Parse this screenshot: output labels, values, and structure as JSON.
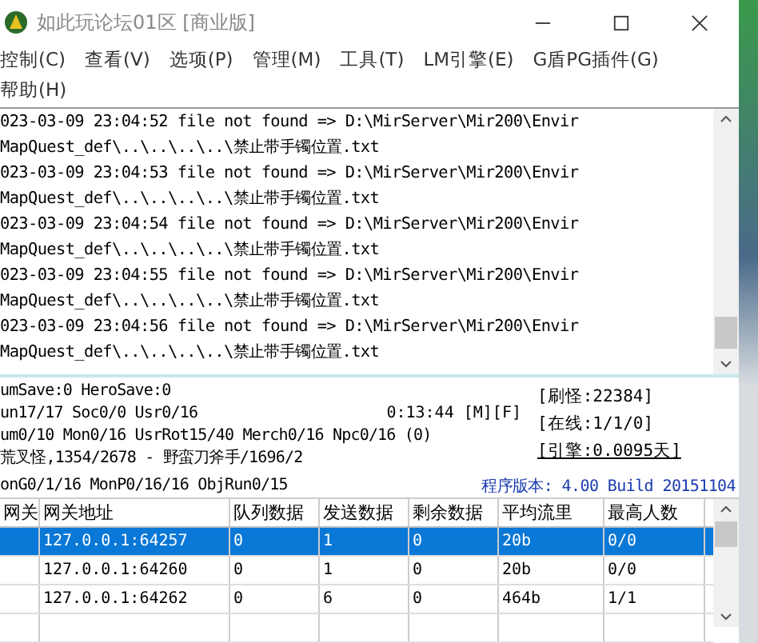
{
  "window": {
    "title": "如此玩论坛01区 [商业版]"
  },
  "menu": [
    {
      "label": "控制(C)"
    },
    {
      "label": "查看(V)"
    },
    {
      "label": "选项(P)"
    },
    {
      "label": "管理(M)"
    },
    {
      "label": "工具(T)"
    },
    {
      "label": "LM引擎(E)"
    },
    {
      "label": "G盾PG插件(G)"
    },
    {
      "label": "帮助(H)"
    }
  ],
  "log": [
    "023-03-09 23:04:52 file not found => D:\\MirServer\\Mir200\\Envir",
    "MapQuest_def\\..\\..\\..\\..\\禁止带手镯位置.txt",
    "023-03-09 23:04:53 file not found => D:\\MirServer\\Mir200\\Envir",
    "MapQuest_def\\..\\..\\..\\..\\禁止带手镯位置.txt",
    "023-03-09 23:04:54 file not found => D:\\MirServer\\Mir200\\Envir",
    "MapQuest_def\\..\\..\\..\\..\\禁止带手镯位置.txt",
    "023-03-09 23:04:55 file not found => D:\\MirServer\\Mir200\\Envir",
    "MapQuest_def\\..\\..\\..\\..\\禁止带手镯位置.txt",
    "023-03-09 23:04:56 file not found => D:\\MirServer\\Mir200\\Envir",
    "MapQuest_def\\..\\..\\..\\..\\禁止带手镯位置.txt"
  ],
  "status": {
    "lines": [
      "umSave:0 HeroSave:0",
      "un17/17 Soc0/0 Usr0/16",
      "um0/10 Mon0/16 UsrRot15/40 Merch0/16 Npc0/16 (0)",
      "荒叉怪,1354/2678 - 野蛮刀斧手/1696/2",
      "onG0/1/16 MonP0/16/16 ObjRun0/15"
    ],
    "clock": "0:13:44 [M][F]",
    "counters": [
      "[刷怪:22384]",
      "[在线:1/1/0]",
      "[引擎:0.0095天]"
    ],
    "version": "程序版本: 4.00 Build 20151104"
  },
  "table": {
    "columns": [
      "网关",
      "网关地址",
      "队列数据",
      "发送数据",
      "剩余数据",
      "平均流里",
      "最高人数"
    ],
    "rows": [
      {
        "selected": true,
        "cells": [
          "",
          "127.0.0.1:64257",
          "0",
          "1",
          "0",
          "20b",
          "0/0"
        ]
      },
      {
        "selected": false,
        "cells": [
          "",
          "127.0.0.1:64260",
          "0",
          "1",
          "0",
          "20b",
          "0/0"
        ]
      },
      {
        "selected": false,
        "cells": [
          "",
          "127.0.0.1:64262",
          "0",
          "6",
          "0",
          "464b",
          "1/1"
        ]
      }
    ]
  }
}
